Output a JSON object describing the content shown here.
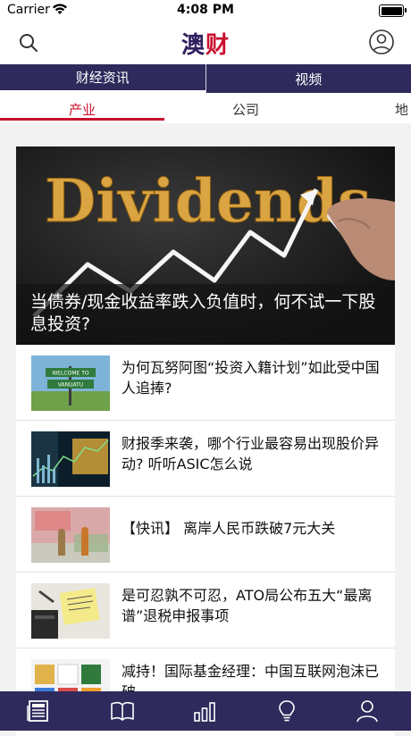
{
  "status_bar": {
    "carrier": "Carrier",
    "time": "4:08 PM"
  },
  "header": {
    "logo_main": "澳",
    "logo_accent": "财"
  },
  "top_tabs": [
    {
      "label": "财经资讯",
      "active": true
    },
    {
      "label": "视频",
      "active": false
    }
  ],
  "categories": [
    {
      "label": "产业",
      "active": true
    },
    {
      "label": "公司",
      "active": false
    },
    {
      "label": "地",
      "active": false
    }
  ],
  "hero": {
    "image_text": "Dividends",
    "caption": "当债券/现金收益率跌入负值时，何不试一下股息投资?"
  },
  "news": [
    {
      "title": "为何瓦努阿图“投资入籍计划”如此受中国人追捧?",
      "thumb_sign_1": "WELCOME TO",
      "thumb_sign_2": "VANUATU"
    },
    {
      "title": "财报季来袭，哪个行业最容易出现股价异动? 听听ASIC怎么说"
    },
    {
      "title": "【快讯】 离岸人民币跌破7元大关"
    },
    {
      "title": "是可忍孰不可忍，ATO局公布五大“最离谱”退税申报事项"
    },
    {
      "title": "减持！国际基金经理：中国互联网泡沫已破"
    }
  ],
  "bottom_nav": [
    {
      "icon": "newspaper-icon",
      "active": true
    },
    {
      "icon": "book-icon",
      "active": false
    },
    {
      "icon": "bar-chart-icon",
      "active": false
    },
    {
      "icon": "lightbulb-icon",
      "active": false
    },
    {
      "icon": "user-icon",
      "active": false
    }
  ],
  "colors": {
    "brand": "#2e2a5c",
    "accent": "#c8102e"
  }
}
